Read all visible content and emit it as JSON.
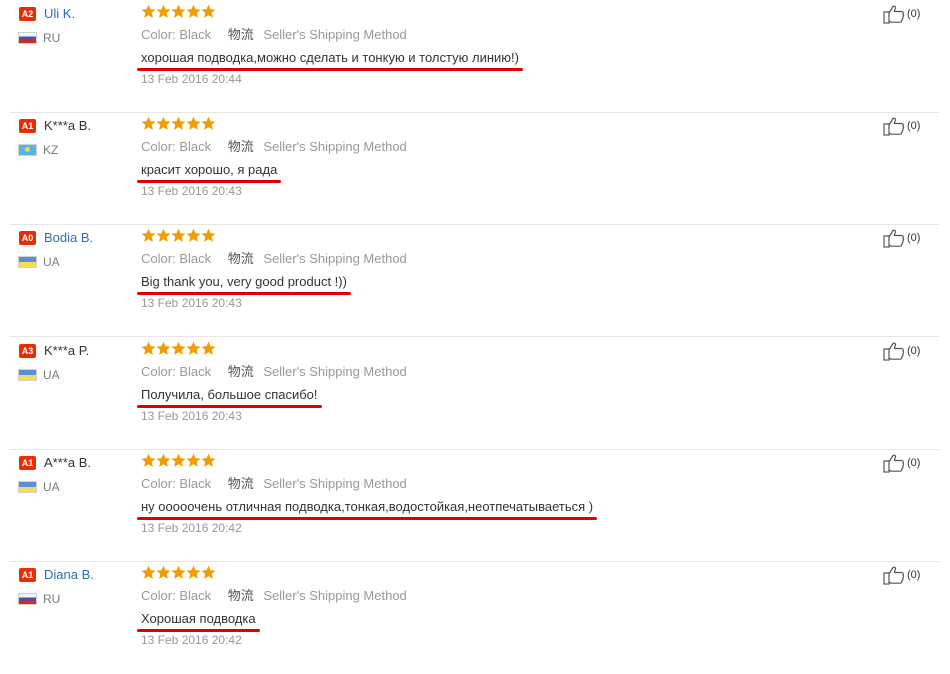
{
  "labels": {
    "color_label": "Color:",
    "shipping_icon": "物流",
    "shipping_method": "Seller's Shipping Method"
  },
  "colors": {
    "badge": "#e62e04",
    "link": "#2a6ebb",
    "star": "#f39c00",
    "underline": "#e00000"
  },
  "reviews": [
    {
      "badge": "A2",
      "name": "Uli K.",
      "name_style": "link",
      "flag_icon": "ru-flag-icon",
      "country": "RU",
      "stars": 5,
      "color": "Black",
      "comment": "хорошая подводка,можно сделать и тонкую и толстую линию!)",
      "date": "13 Feb 2016 20:44",
      "likes": "(0)"
    },
    {
      "badge": "A1",
      "name": "K***a B.",
      "name_style": "plain",
      "flag_icon": "kz-flag-icon",
      "country": "KZ",
      "stars": 5,
      "color": "Black",
      "comment": "красит хорошо, я рада",
      "date": "13 Feb 2016 20:43",
      "likes": "(0)"
    },
    {
      "badge": "A0",
      "name": "Bodia B.",
      "name_style": "link",
      "flag_icon": "ua-flag-icon",
      "country": "UA",
      "stars": 5,
      "color": "Black",
      "comment": "Big thank you, very good product !))",
      "date": "13 Feb 2016 20:43",
      "likes": "(0)"
    },
    {
      "badge": "A3",
      "name": "K***a P.",
      "name_style": "plain",
      "flag_icon": "ua-flag-icon",
      "country": "UA",
      "stars": 5,
      "color": "Black",
      "comment": "Получила, большое спасибо!",
      "date": "13 Feb 2016 20:43",
      "likes": "(0)"
    },
    {
      "badge": "A1",
      "name": "A***a B.",
      "name_style": "plain",
      "flag_icon": "ua-flag-icon",
      "country": "UA",
      "stars": 5,
      "color": "Black",
      "comment": "ну ооооочень отличная подводка,тонкая,водостойкая,неотпечатываеться )",
      "date": "13 Feb 2016 20:42",
      "likes": "(0)"
    },
    {
      "badge": "A1",
      "name": "Diana B.",
      "name_style": "link",
      "flag_icon": "ru-flag-icon",
      "country": "RU",
      "stars": 5,
      "color": "Black",
      "comment": "Хорошая подводка",
      "date": "13 Feb 2016 20:42",
      "likes": "(0)"
    }
  ]
}
